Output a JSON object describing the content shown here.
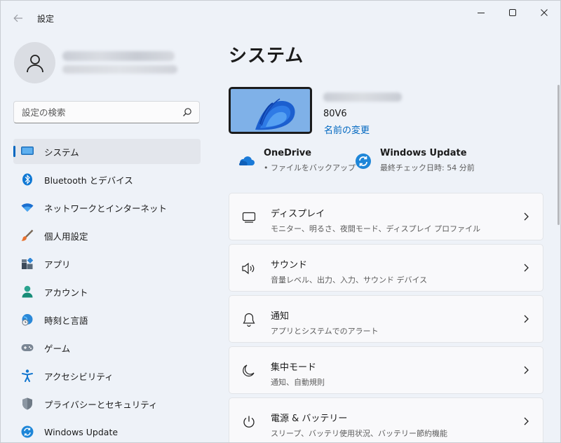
{
  "window": {
    "title": "設定",
    "controls": {
      "minimize": "minimize-icon",
      "maximize": "maximize-icon",
      "close": "close-icon"
    }
  },
  "sidebar": {
    "search": {
      "placeholder": "設定の検索",
      "value": ""
    },
    "items": [
      {
        "label": "システム",
        "icon": "display-icon",
        "active": true
      },
      {
        "label": "Bluetooth とデバイス",
        "icon": "bluetooth-icon",
        "active": false
      },
      {
        "label": "ネットワークとインターネット",
        "icon": "wifi-icon",
        "active": false
      },
      {
        "label": "個人用設定",
        "icon": "brush-icon",
        "active": false
      },
      {
        "label": "アプリ",
        "icon": "apps-icon",
        "active": false
      },
      {
        "label": "アカウント",
        "icon": "account-icon",
        "active": false
      },
      {
        "label": "時刻と言語",
        "icon": "globe-clock-icon",
        "active": false
      },
      {
        "label": "ゲーム",
        "icon": "gamepad-icon",
        "active": false
      },
      {
        "label": "アクセシビリティ",
        "icon": "accessibility-icon",
        "active": false
      },
      {
        "label": "プライバシーとセキュリティ",
        "icon": "shield-icon",
        "active": false
      },
      {
        "label": "Windows Update",
        "icon": "update-icon",
        "active": false
      }
    ]
  },
  "main": {
    "title": "システム",
    "device": {
      "model": "80V6",
      "rename_link": "名前の変更"
    },
    "quick": [
      {
        "title": "OneDrive",
        "subtitle": "• ファイルをバックアップ",
        "icon": "cloud-icon"
      },
      {
        "title": "Windows Update",
        "subtitle": "最終チェック日時: 54 分前",
        "icon": "update-icon"
      }
    ],
    "cards": [
      {
        "title": "ディスプレイ",
        "subtitle": "モニター、明るさ、夜間モード、ディスプレイ プロファイル",
        "icon": "monitor-icon"
      },
      {
        "title": "サウンド",
        "subtitle": "音量レベル、出力、入力、サウンド デバイス",
        "icon": "speaker-icon"
      },
      {
        "title": "通知",
        "subtitle": "アプリとシステムでのアラート",
        "icon": "bell-icon"
      },
      {
        "title": "集中モード",
        "subtitle": "通知、自動規則",
        "icon": "moon-icon"
      },
      {
        "title": "電源 & バッテリー",
        "subtitle": "スリープ、バッテリ使用状況、バッテリー節約機能",
        "icon": "power-icon"
      }
    ]
  },
  "colors": {
    "accent": "#0067c0",
    "background": "#eef2f8",
    "card": "#f9f9fb"
  }
}
